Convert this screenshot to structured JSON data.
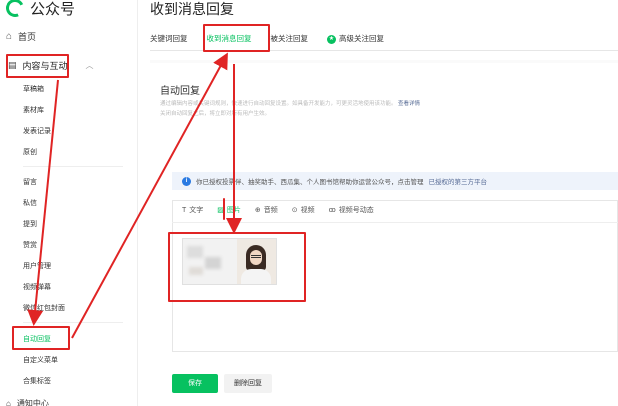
{
  "brand": {
    "name": "公众号",
    "logo_icon": "wechat-logo-icon"
  },
  "sidebar": {
    "home_label": "首页",
    "group_label": "内容与互动",
    "items": [
      "草稿箱",
      "素材库",
      "发表记录",
      "原创",
      "留言",
      "私信",
      "提到",
      "赞赏",
      "用户管理",
      "视频弹幕",
      "微信红包封面",
      "自动回复",
      "自定义菜单",
      "合集标签"
    ],
    "active_item": "自动回复",
    "bottom_label": "通知中心"
  },
  "header": {
    "title": "收到消息回复"
  },
  "tabs": [
    {
      "label": "关键词回复"
    },
    {
      "label": "收到消息回复"
    },
    {
      "label": "被关注回复"
    },
    {
      "label": "高级关注回复"
    }
  ],
  "main": {
    "section_title": "自动回复",
    "desc_line1": "通过编辑内容或关键词规则，快速进行自动回复设置。如具备开发能力，可更灵活地使用该功能。",
    "desc_link": "查看详情",
    "desc_line2": "关闭自动回复之后，将立即对所有用户生效。",
    "info_text": "你已授权公众号",
    "info_text_full": "你已授权投票伴、抽奖助手、西瓜集、个人图书馆帮助你运营公众号，点击管理",
    "info_link": "已授权的第三方平台",
    "toolbar": [
      {
        "label": "文字",
        "icon": "text-icon"
      },
      {
        "label": "图片",
        "icon": "image-icon"
      },
      {
        "label": "音频",
        "icon": "audio-icon"
      },
      {
        "label": "视频",
        "icon": "video-icon"
      },
      {
        "label": "视频号动态",
        "icon": "channels-icon"
      }
    ],
    "save_label": "保存",
    "delete_label": "删除回复"
  },
  "colors": {
    "accent": "#07c160",
    "highlight": "#e02424",
    "link": "#576b95"
  }
}
